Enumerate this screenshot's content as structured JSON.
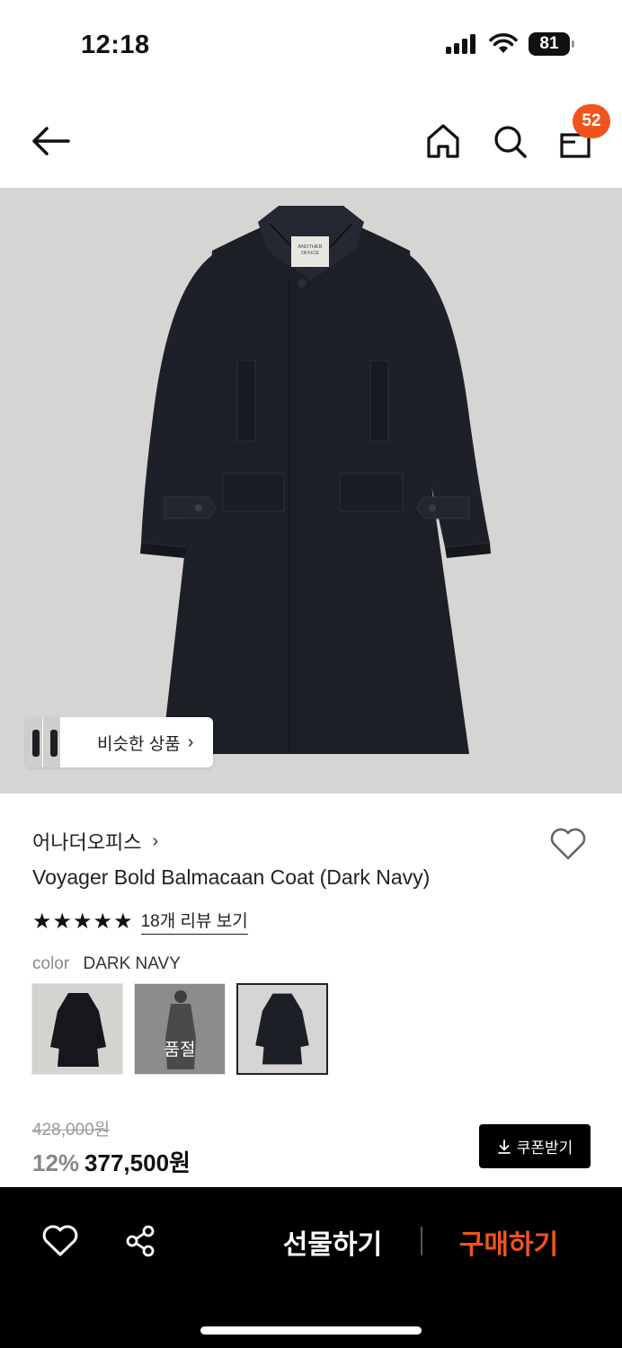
{
  "status": {
    "time": "12:18",
    "battery": "81"
  },
  "nav": {
    "bag_count": "52"
  },
  "image": {
    "similar_label": "비슷한 상품",
    "chevron": "›"
  },
  "product": {
    "brand": "어나더오피스",
    "brand_chevron": "›",
    "title": "Voyager Bold Balmacaan Coat (Dark Navy)",
    "stars": "★★★★★",
    "review_link": "18개 리뷰 보기",
    "color_label": "color",
    "color_value": "DARK NAVY"
  },
  "swatches": [
    {
      "name": "black-coat",
      "soldout": ""
    },
    {
      "name": "grey-model",
      "soldout": "품절"
    },
    {
      "name": "dark-navy-coat",
      "soldout": ""
    }
  ],
  "price": {
    "original": "428,000원",
    "discount": "12%",
    "final": "377,500원",
    "coupon_label": "쿠폰받기"
  },
  "bottom": {
    "gift_label": "선물하기",
    "buy_label": "구매하기"
  },
  "colors": {
    "accent": "#f0541c",
    "coat": "#1d1f27",
    "image_bg": "#d6d5d3"
  },
  "icons": [
    "back-arrow-icon",
    "home-icon",
    "search-icon",
    "bag-icon",
    "heart-icon",
    "share-icon",
    "download-icon"
  ]
}
